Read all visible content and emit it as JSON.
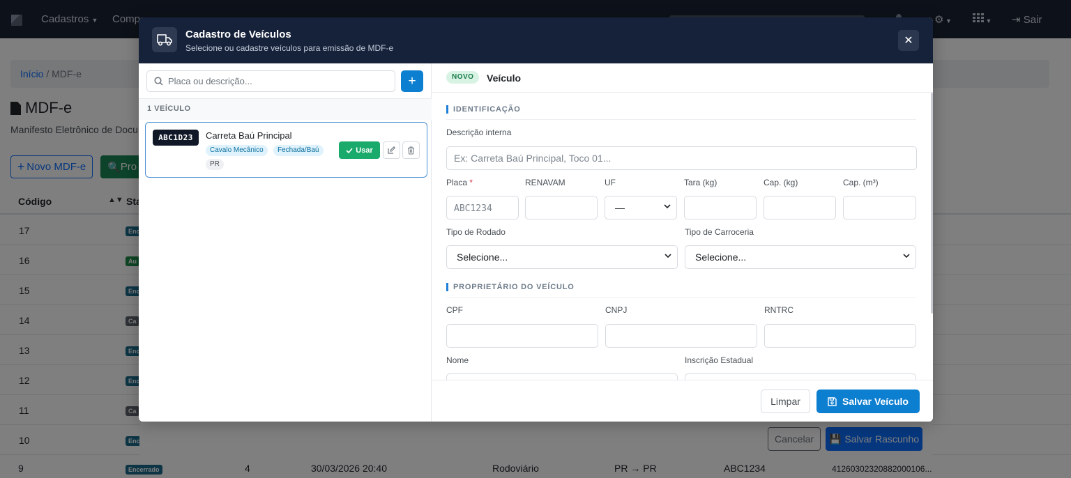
{
  "nav": {
    "items": [
      "Cadastros",
      "Comp"
    ],
    "right_label": "Sair"
  },
  "breadcrumb": {
    "home": "Início",
    "separator": "/",
    "current": "MDF-e"
  },
  "page": {
    "title": "MDF-e",
    "subtitle": "Manifesto Eletrônico de Docu",
    "new_button": "Novo MDF-e",
    "proc_button": "Pro"
  },
  "table": {
    "headers": {
      "code": "Código",
      "status": "Sta"
    },
    "rows": [
      {
        "code": "17",
        "badge": "Enc",
        "color": "#1a6b8a"
      },
      {
        "code": "16",
        "badge": "Au",
        "color": "#1f8a4a"
      },
      {
        "code": "15",
        "badge": "Enc",
        "color": "#1a6b8a"
      },
      {
        "code": "14",
        "badge": "Ca",
        "color": "#5c636a"
      },
      {
        "code": "13",
        "badge": "Enc",
        "color": "#1a6b8a"
      },
      {
        "code": "12",
        "badge": "Enc",
        "color": "#1a6b8a"
      },
      {
        "code": "11",
        "badge": "Ca",
        "color": "#5c636a"
      },
      {
        "code": "10",
        "badge": "Enc",
        "color": "#1a6b8a"
      }
    ],
    "last_row": {
      "code": "9",
      "badge": "Encerrado",
      "number": "4",
      "datetime": "30/03/2026 20:40",
      "modal": "Rodoviário",
      "route": "PR → PR",
      "plate": "ABC1234",
      "key": "41260302320882000106..."
    }
  },
  "under_footer": {
    "cancel": "Cancelar",
    "save": "Salvar Rascunho"
  },
  "modal": {
    "title": "Cadastro de Veículos",
    "subtitle": "Selecione ou cadastre veículos para emissão de MDF-e",
    "search_placeholder": "Placa ou descrição...",
    "count_label": "1 VEÍCULO",
    "vehicle": {
      "plate": "ABC1D23",
      "name": "Carreta Baú Principal",
      "tags": [
        "Cavalo Mecânico",
        "Fechada/Baú",
        "PR"
      ],
      "use_button": "Usar"
    },
    "form": {
      "badge": "NOVO",
      "title": "Veículo",
      "section_id": "IDENTIFICAÇÃO",
      "desc_label": "Descrição interna",
      "desc_placeholder": "Ex: Carreta Baú Principal, Toco 01...",
      "placa_label": "Placa",
      "placa_required": "*",
      "placa_placeholder": "ABC1234",
      "renavam_label": "RENAVAM",
      "uf_label": "UF",
      "uf_value": "—",
      "tara_label": "Tara (kg)",
      "capkg_label": "Cap. (kg)",
      "capm3_label": "Cap. (m³)",
      "rodado_label": "Tipo de Rodado",
      "rodado_value": "Selecione...",
      "carroceria_label": "Tipo de Carroceria",
      "carroceria_value": "Selecione...",
      "section_owner": "PROPRIETÁRIO DO VEÍCULO",
      "cpf_label": "CPF",
      "cnpj_label": "CNPJ",
      "rntrc_label": "RNTRC",
      "nome_label": "Nome",
      "ie_label": "Inscrição Estadual"
    },
    "footer": {
      "clear": "Limpar",
      "save": "Salvar Veículo"
    }
  }
}
